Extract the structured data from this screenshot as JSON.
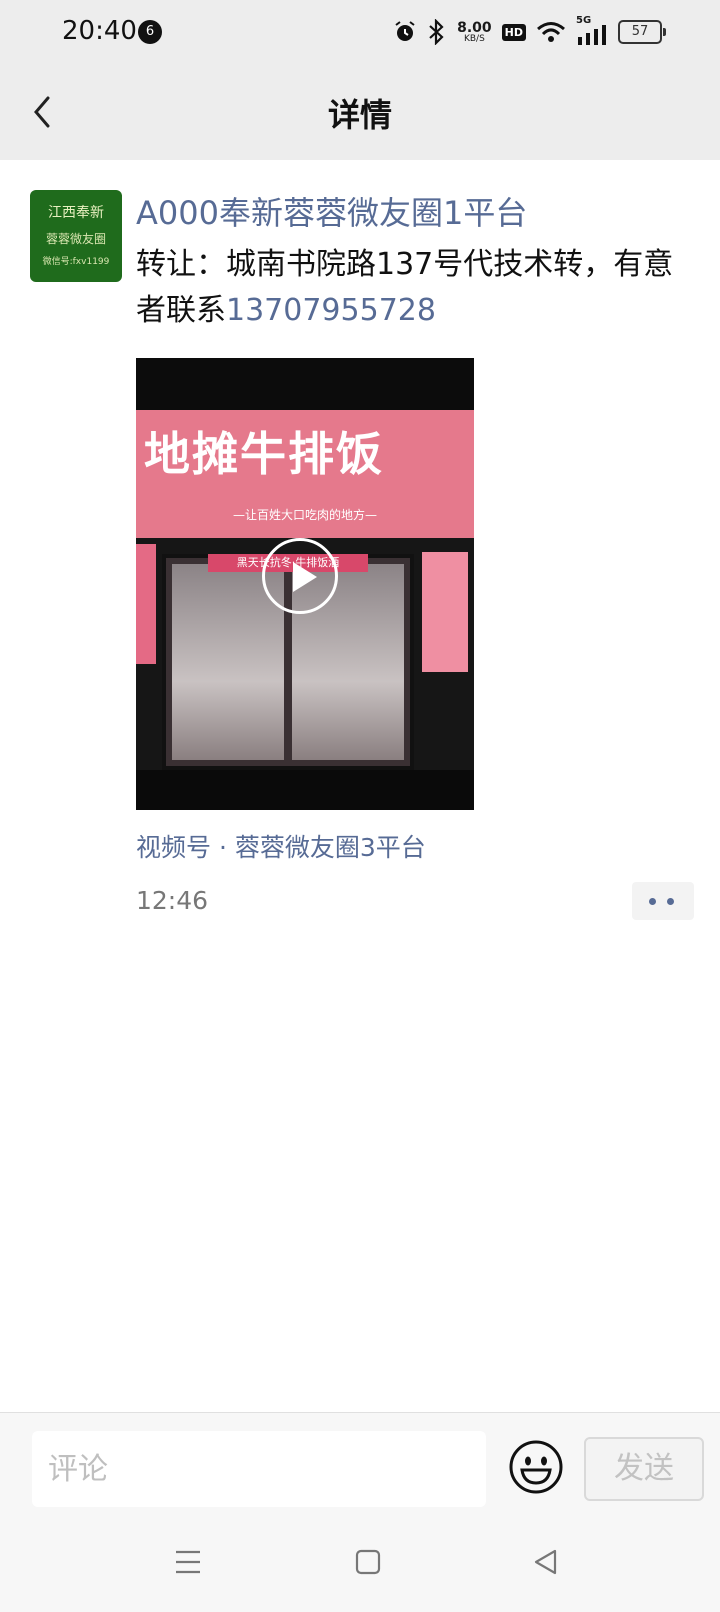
{
  "status_bar": {
    "time": "20:40",
    "notification_count": "6",
    "net_speed": "8.00",
    "net_speed_unit": "KB/S",
    "hd_label": "HD",
    "signal_label": "5G",
    "battery": "57"
  },
  "header": {
    "title": "详情"
  },
  "post": {
    "avatar_text": {
      "line1": "江西奉新",
      "line2": "蓉蓉微友圈",
      "line3": "微信号:fxv1199"
    },
    "username": "A000奉新蓉蓉微友圈1平台",
    "content_text": "转让：城南书院路137号代技术转，有意者联系",
    "content_phone": "13707955728",
    "video_thumbnail": {
      "sign_text": "地摊牛排饭",
      "sign_subtitle": "—让百姓大口吃肉的地方—",
      "door_sign": "黑天长抗冬·牛排饭酒"
    },
    "channel_label": "视频号 · 蓉蓉微友圈3平台",
    "time": "12:46"
  },
  "comment_bar": {
    "placeholder": "评论",
    "send_label": "发送"
  },
  "icons": {
    "back": "chevron-left-icon",
    "play": "play-icon",
    "more": "more-dots-icon",
    "emoji": "smiley-icon",
    "menu": "menu-icon",
    "home": "home-square-icon",
    "back_triangle": "back-triangle-icon"
  },
  "colors": {
    "link_blue": "#576b95",
    "header_bg": "#ededed",
    "sign_pink": "#e5798c",
    "avatar_green": "#1f6b1c"
  }
}
